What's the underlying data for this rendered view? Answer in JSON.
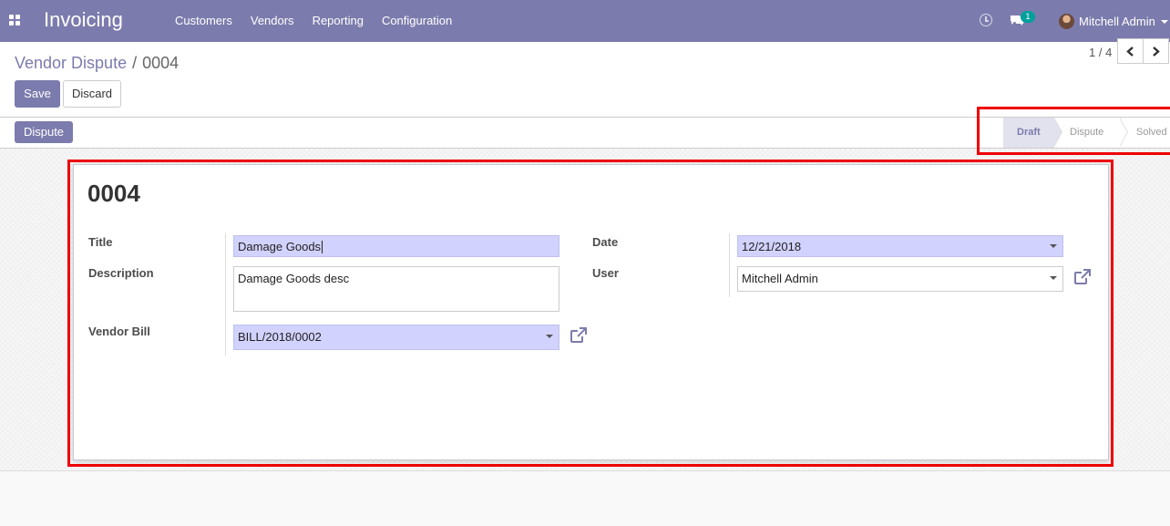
{
  "navbar": {
    "app_title": "Invoicing",
    "menu": [
      {
        "label": "Customers"
      },
      {
        "label": "Vendors"
      },
      {
        "label": "Reporting"
      },
      {
        "label": "Configuration"
      }
    ],
    "icons": {
      "apps": "apps-grid-icon",
      "activity": "clock-icon",
      "messages": "chat-icon"
    },
    "chat_count": "1",
    "user_name": "Mitchell Admin",
    "color": "#7c7bad"
  },
  "breadcrumb": {
    "parent": "Vendor Dispute",
    "separator": "/",
    "current": "0004"
  },
  "actions": {
    "save": "Save",
    "discard": "Discard"
  },
  "pager": {
    "value": "1 / 4"
  },
  "statusbar": {
    "action_button": "Dispute",
    "stages": [
      {
        "label": "Draft",
        "active": true
      },
      {
        "label": "Dispute",
        "active": false
      },
      {
        "label": "Solved",
        "active": false
      }
    ]
  },
  "form": {
    "record_name": "0004",
    "left": {
      "title_label": "Title",
      "title_value": "Damage Goods",
      "description_label": "Description",
      "description_value": "Damage Goods desc",
      "vendor_bill_label": "Vendor Bill",
      "vendor_bill_value": "BILL/2018/0002"
    },
    "right": {
      "date_label": "Date",
      "date_value": "12/21/2018",
      "user_label": "User",
      "user_value": "Mitchell Admin"
    }
  },
  "colors": {
    "accent": "#7c7bad",
    "required_field": "#d2d2ff",
    "annotation": "#e00000"
  }
}
